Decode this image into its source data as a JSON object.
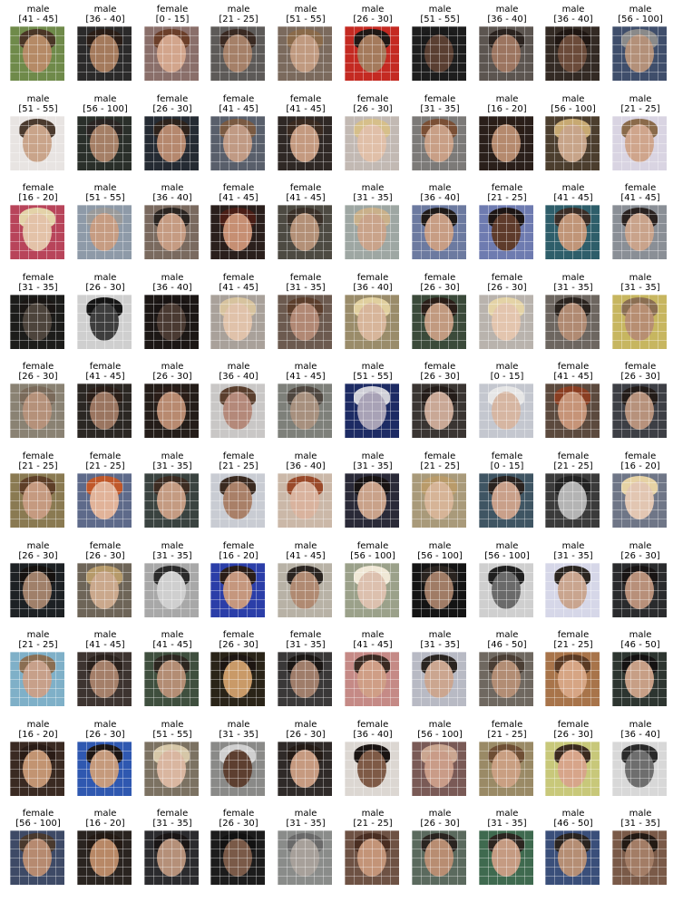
{
  "faces": [
    {
      "gender": "male",
      "age": "[41 - 45]",
      "palette": {
        "bg": "#6f8a4a",
        "skin": "#b58a66",
        "hair": "#4a3626"
      }
    },
    {
      "gender": "male",
      "age": "[36 - 40]",
      "palette": {
        "bg": "#2b2a2a",
        "skin": "#a47a5c",
        "hair": "#2a1d16"
      }
    },
    {
      "gender": "female",
      "age": "[0 - 15]",
      "palette": {
        "bg": "#8a6f6a",
        "skin": "#d2a58c",
        "hair": "#6b3f2a"
      }
    },
    {
      "gender": "male",
      "age": "[21 - 25]",
      "palette": {
        "bg": "#5d5a58",
        "skin": "#a58068",
        "hair": "#3a2a22"
      }
    },
    {
      "gender": "male",
      "age": "[51 - 55]",
      "palette": {
        "bg": "#7b6a5d",
        "skin": "#c09a80",
        "hair": "#8a6a4a"
      }
    },
    {
      "gender": "male",
      "age": "[26 - 30]",
      "palette": {
        "bg": "#c42a22",
        "skin": "#a47a5c",
        "hair": "#1e1714"
      }
    },
    {
      "gender": "male",
      "age": "[51 - 55]",
      "palette": {
        "bg": "#1d1d1d",
        "skin": "#5a3f32",
        "hair": "#1a1a1a"
      }
    },
    {
      "gender": "male",
      "age": "[36 - 40]",
      "palette": {
        "bg": "#5c5550",
        "skin": "#9c7560",
        "hair": "#2b231f"
      }
    },
    {
      "gender": "male",
      "age": "[36 - 40]",
      "palette": {
        "bg": "#332a24",
        "skin": "#6b4b3a",
        "hair": "#1f1612"
      }
    },
    {
      "gender": "male",
      "age": "[56 - 100]",
      "palette": {
        "bg": "#3f4e6b",
        "skin": "#b39079",
        "hair": "#8a8a8a"
      }
    },
    {
      "gender": "male",
      "age": "[51 - 55]",
      "palette": {
        "bg": "#e8e4e2",
        "skin": "#c9a48a",
        "hair": "#4b3a2e"
      }
    },
    {
      "gender": "male",
      "age": "[56 - 100]",
      "palette": {
        "bg": "#2a2f2a",
        "skin": "#a57f66",
        "hair": "#2a2422"
      }
    },
    {
      "gender": "female",
      "age": "[26 - 30]",
      "palette": {
        "bg": "#252b33",
        "skin": "#b5886e",
        "hair": "#2e231c"
      }
    },
    {
      "gender": "female",
      "age": "[41 - 45]",
      "palette": {
        "bg": "#595f6b",
        "skin": "#c09a84",
        "hair": "#7a5a42"
      }
    },
    {
      "gender": "female",
      "age": "[41 - 45]",
      "palette": {
        "bg": "#2f2825",
        "skin": "#c49a80",
        "hair": "#3a2a20"
      }
    },
    {
      "gender": "female",
      "age": "[26 - 30]",
      "palette": {
        "bg": "#c2b9b3",
        "skin": "#e0bfa8",
        "hair": "#d6bf8a"
      }
    },
    {
      "gender": "female",
      "age": "[31 - 35]",
      "palette": {
        "bg": "#7c7a78",
        "skin": "#c89f86",
        "hair": "#7a4f35"
      }
    },
    {
      "gender": "male",
      "age": "[16 - 20]",
      "palette": {
        "bg": "#2a1f1a",
        "skin": "#b58a6e",
        "hair": "#2a1d16"
      }
    },
    {
      "gender": "male",
      "age": "[56 - 100]",
      "palette": {
        "bg": "#4c3e2e",
        "skin": "#c7a489",
        "hair": "#c7a972"
      }
    },
    {
      "gender": "male",
      "age": "[21 - 25]",
      "palette": {
        "bg": "#d9d4e2",
        "skin": "#cfa58c",
        "hair": "#8a6a4a"
      }
    },
    {
      "gender": "female",
      "age": "[16 - 20]",
      "palette": {
        "bg": "#b8445a",
        "skin": "#e3c2a8",
        "hair": "#e3d2a8"
      }
    },
    {
      "gender": "male",
      "age": "[51 - 55]",
      "palette": {
        "bg": "#8e9aa8",
        "skin": "#c69c82",
        "hair": "#9a9a9a"
      }
    },
    {
      "gender": "male",
      "age": "[36 - 40]",
      "palette": {
        "bg": "#7a6a5f",
        "skin": "#c59b82",
        "hair": "#2a2420"
      }
    },
    {
      "gender": "female",
      "age": "[41 - 45]",
      "palette": {
        "bg": "#2a1f1c",
        "skin": "#c68f73",
        "hair": "#4a1e16"
      }
    },
    {
      "gender": "female",
      "age": "[41 - 45]",
      "palette": {
        "bg": "#4d4a42",
        "skin": "#b39077",
        "hair": "#3a3028"
      }
    },
    {
      "gender": "male",
      "age": "[31 - 35]",
      "palette": {
        "bg": "#9ea7a3",
        "skin": "#c9a38a",
        "hair": "#c9b08a"
      }
    },
    {
      "gender": "male",
      "age": "[36 - 40]",
      "palette": {
        "bg": "#6c7aa0",
        "skin": "#c79d84",
        "hair": "#1f1a18"
      }
    },
    {
      "gender": "female",
      "age": "[21 - 25]",
      "palette": {
        "bg": "#6e7bb0",
        "skin": "#5e3b2b",
        "hair": "#1c1514"
      }
    },
    {
      "gender": "male",
      "age": "[41 - 45]",
      "palette": {
        "bg": "#2e5e6a",
        "skin": "#c09578",
        "hair": "#3a2d26"
      }
    },
    {
      "gender": "female",
      "age": "[41 - 45]",
      "palette": {
        "bg": "#8a8f96",
        "skin": "#c9a38b",
        "hair": "#2a2220"
      }
    },
    {
      "gender": "female",
      "age": "[31 - 35]",
      "palette": {
        "bg": "#1c1c1a",
        "skin": "#4d443c",
        "hair": "#1a1614"
      }
    },
    {
      "gender": "male",
      "age": "[26 - 30]",
      "palette": {
        "bg": "#cfcfcf",
        "skin": "#3d3d3d",
        "hair": "#141414"
      }
    },
    {
      "gender": "male",
      "age": "[36 - 40]",
      "palette": {
        "bg": "#1c1715",
        "skin": "#4a3a32",
        "hair": "#181312"
      }
    },
    {
      "gender": "female",
      "age": "[41 - 45]",
      "palette": {
        "bg": "#a9a19a",
        "skin": "#e0c2aa",
        "hair": "#d7c39e"
      }
    },
    {
      "gender": "female",
      "age": "[31 - 35]",
      "palette": {
        "bg": "#6c5a4f",
        "skin": "#b18874",
        "hair": "#5c3e2c"
      }
    },
    {
      "gender": "female",
      "age": "[36 - 40]",
      "palette": {
        "bg": "#9a8c6a",
        "skin": "#d7b59a",
        "hair": "#e0cf9e"
      }
    },
    {
      "gender": "female",
      "age": "[26 - 30]",
      "palette": {
        "bg": "#3b4a3a",
        "skin": "#c19a80",
        "hair": "#2a1e18"
      }
    },
    {
      "gender": "female",
      "age": "[26 - 30]",
      "palette": {
        "bg": "#b9b3ad",
        "skin": "#e3c5ae",
        "hair": "#e4d3a6"
      }
    },
    {
      "gender": "male",
      "age": "[31 - 35]",
      "palette": {
        "bg": "#6d6660",
        "skin": "#b08a72",
        "hair": "#2a231e"
      }
    },
    {
      "gender": "male",
      "age": "[31 - 35]",
      "palette": {
        "bg": "#c7b660",
        "skin": "#b78e72",
        "hair": "#8a6e52"
      }
    },
    {
      "gender": "female",
      "age": "[26 - 30]",
      "palette": {
        "bg": "#8a8273",
        "skin": "#b5917a",
        "hair": "#7a6a5a"
      }
    },
    {
      "gender": "female",
      "age": "[41 - 45]",
      "palette": {
        "bg": "#2b2723",
        "skin": "#9a7560",
        "hair": "#2a1e18"
      }
    },
    {
      "gender": "male",
      "age": "[26 - 30]",
      "palette": {
        "bg": "#241d19",
        "skin": "#b88a70",
        "hair": "#2a1d18"
      }
    },
    {
      "gender": "male",
      "age": "[36 - 40]",
      "palette": {
        "bg": "#c9c7c6",
        "skin": "#b4897a",
        "hair": "#5a3f2e"
      }
    },
    {
      "gender": "male",
      "age": "[41 - 45]",
      "palette": {
        "bg": "#7e807a",
        "skin": "#a7907e",
        "hair": "#4f4740"
      }
    },
    {
      "gender": "male",
      "age": "[51 - 55]",
      "palette": {
        "bg": "#1d2b64",
        "skin": "#a8a2b6",
        "hair": "#d0d0d8"
      }
    },
    {
      "gender": "female",
      "age": "[26 - 30]",
      "palette": {
        "bg": "#3a3532",
        "skin": "#c9a896",
        "hair": "#241c19"
      }
    },
    {
      "gender": "male",
      "age": "[0 - 15]",
      "palette": {
        "bg": "#c4c7cf",
        "skin": "#d6b6a2",
        "hair": "#e6e6e6"
      }
    },
    {
      "gender": "female",
      "age": "[41 - 45]",
      "palette": {
        "bg": "#5c4a3e",
        "skin": "#c69478",
        "hair": "#8a3e22"
      }
    },
    {
      "gender": "female",
      "age": "[26 - 30]",
      "palette": {
        "bg": "#3d3f45",
        "skin": "#b7927c",
        "hair": "#231c19"
      }
    },
    {
      "gender": "female",
      "age": "[21 - 25]",
      "palette": {
        "bg": "#8a7a52",
        "skin": "#c59a80",
        "hair": "#5e3f28"
      }
    },
    {
      "gender": "female",
      "age": "[21 - 25]",
      "palette": {
        "bg": "#5e6a8a",
        "skin": "#e1b399",
        "hair": "#c0582a"
      }
    },
    {
      "gender": "male",
      "age": "[31 - 35]",
      "palette": {
        "bg": "#3a4340",
        "skin": "#c49b82",
        "hair": "#3c2c22"
      }
    },
    {
      "gender": "female",
      "age": "[21 - 25]",
      "palette": {
        "bg": "#c9ccd3",
        "skin": "#a98068",
        "hair": "#3a2a20"
      }
    },
    {
      "gender": "male",
      "age": "[36 - 40]",
      "palette": {
        "bg": "#cbb8a8",
        "skin": "#d9b39e",
        "hair": "#9a4a2a"
      }
    },
    {
      "gender": "male",
      "age": "[31 - 35]",
      "palette": {
        "bg": "#2a2a38",
        "skin": "#c9a28a",
        "hair": "#171313"
      }
    },
    {
      "gender": "female",
      "age": "[21 - 25]",
      "palette": {
        "bg": "#a99a7a",
        "skin": "#d6b497",
        "hair": "#b99b6a"
      }
    },
    {
      "gender": "female",
      "age": "[0 - 15]",
      "palette": {
        "bg": "#3f5563",
        "skin": "#c9a08a",
        "hair": "#2a2320"
      }
    },
    {
      "gender": "female",
      "age": "[21 - 25]",
      "palette": {
        "bg": "#3b3b3b",
        "skin": "#b4b4b4",
        "hair": "#222222"
      }
    },
    {
      "gender": "female",
      "age": "[16 - 20]",
      "palette": {
        "bg": "#6f7687",
        "skin": "#e2c6b2",
        "hair": "#e6d2a4"
      }
    },
    {
      "gender": "male",
      "age": "[26 - 30]",
      "palette": {
        "bg": "#1d2124",
        "skin": "#a0806a",
        "hair": "#161210"
      }
    },
    {
      "gender": "female",
      "age": "[26 - 30]",
      "palette": {
        "bg": "#6e6558",
        "skin": "#caa88c",
        "hair": "#b69a6a"
      }
    },
    {
      "gender": "male",
      "age": "[31 - 35]",
      "palette": {
        "bg": "#a8a8a8",
        "skin": "#cfcfcf",
        "hair": "#2a2a2a"
      }
    },
    {
      "gender": "female",
      "age": "[16 - 20]",
      "palette": {
        "bg": "#2b3ea8",
        "skin": "#c5977e",
        "hair": "#2a1d18"
      }
    },
    {
      "gender": "male",
      "age": "[41 - 45]",
      "palette": {
        "bg": "#b8b2a6",
        "skin": "#b08a72",
        "hair": "#2a2420"
      }
    },
    {
      "gender": "female",
      "age": "[56 - 100]",
      "palette": {
        "bg": "#9ba18a",
        "skin": "#dcc0ae",
        "hair": "#f0e8d6"
      }
    },
    {
      "gender": "male",
      "age": "[56 - 100]",
      "palette": {
        "bg": "#141414",
        "skin": "#a07c66",
        "hair": "#2a2420"
      }
    },
    {
      "gender": "male",
      "age": "[56 - 100]",
      "palette": {
        "bg": "#cfcfcf",
        "skin": "#6a6a6a",
        "hair": "#1f1f1f"
      }
    },
    {
      "gender": "male",
      "age": "[31 - 35]",
      "palette": {
        "bg": "#d6d7e8",
        "skin": "#c9a58f",
        "hair": "#2a2520"
      }
    },
    {
      "gender": "male",
      "age": "[26 - 30]",
      "palette": {
        "bg": "#2a2b2d",
        "skin": "#b8907a",
        "hair": "#181414"
      }
    },
    {
      "gender": "male",
      "age": "[21 - 25]",
      "palette": {
        "bg": "#7fb0c8",
        "skin": "#c7a08a",
        "hair": "#8a6e52"
      }
    },
    {
      "gender": "male",
      "age": "[41 - 45]",
      "palette": {
        "bg": "#3d3430",
        "skin": "#a47f69",
        "hair": "#2a211c"
      }
    },
    {
      "gender": "male",
      "age": "[41 - 45]",
      "palette": {
        "bg": "#3f4f3e",
        "skin": "#b38d74",
        "hair": "#2c2620"
      }
    },
    {
      "gender": "female",
      "age": "[26 - 30]",
      "palette": {
        "bg": "#2a2418",
        "skin": "#c99a68",
        "hair": "#1d1612"
      }
    },
    {
      "gender": "female",
      "age": "[31 - 35]",
      "palette": {
        "bg": "#3a3838",
        "skin": "#9f7d6a",
        "hair": "#1a1614"
      }
    },
    {
      "gender": "male",
      "age": "[41 - 45]",
      "palette": {
        "bg": "#c58a86",
        "skin": "#cf9e86",
        "hair": "#3a2a22"
      }
    },
    {
      "gender": "male",
      "age": "[31 - 35]",
      "palette": {
        "bg": "#b8bac4",
        "skin": "#cba690",
        "hair": "#2a2420"
      }
    },
    {
      "gender": "male",
      "age": "[46 - 50]",
      "palette": {
        "bg": "#6f6860",
        "skin": "#b28d74",
        "hair": "#4a3e34"
      }
    },
    {
      "gender": "female",
      "age": "[21 - 25]",
      "palette": {
        "bg": "#a8744a",
        "skin": "#d6a584",
        "hair": "#5a3a24"
      }
    },
    {
      "gender": "male",
      "age": "[46 - 50]",
      "palette": {
        "bg": "#2d3530",
        "skin": "#c79f86",
        "hair": "#141212"
      }
    },
    {
      "gender": "male",
      "age": "[16 - 20]",
      "palette": {
        "bg": "#3a2a22",
        "skin": "#c29472",
        "hair": "#2a1c16"
      }
    },
    {
      "gender": "male",
      "age": "[26 - 30]",
      "palette": {
        "bg": "#2f58b0",
        "skin": "#c59a7c",
        "hair": "#1c1614"
      }
    },
    {
      "gender": "male",
      "age": "[51 - 55]",
      "palette": {
        "bg": "#7c7262",
        "skin": "#d9b6a0",
        "hair": "#d6c7a8"
      }
    },
    {
      "gender": "male",
      "age": "[31 - 35]",
      "palette": {
        "bg": "#8a8a88",
        "skin": "#5d3f30",
        "hair": "#d0d0d0"
      }
    },
    {
      "gender": "male",
      "age": "[26 - 30]",
      "palette": {
        "bg": "#2f2a28",
        "skin": "#c69a80",
        "hair": "#241b16"
      }
    },
    {
      "gender": "female",
      "age": "[36 - 40]",
      "palette": {
        "bg": "#dcd7d2",
        "skin": "#7e5a46",
        "hair": "#1a1412"
      }
    },
    {
      "gender": "male",
      "age": "[56 - 100]",
      "palette": {
        "bg": "#7a5a56",
        "skin": "#c99c88",
        "hair": "#caa690"
      }
    },
    {
      "gender": "female",
      "age": "[21 - 25]",
      "palette": {
        "bg": "#9a8a66",
        "skin": "#c99f82",
        "hair": "#6e4e34"
      }
    },
    {
      "gender": "female",
      "age": "[26 - 30]",
      "palette": {
        "bg": "#c8c87a",
        "skin": "#d7a58a",
        "hair": "#3a2a1f"
      }
    },
    {
      "gender": "male",
      "age": "[36 - 40]",
      "palette": {
        "bg": "#d8d8d8",
        "skin": "#6e6e6e",
        "hair": "#2a2a2a"
      }
    },
    {
      "gender": "female",
      "age": "[56 - 100]",
      "palette": {
        "bg": "#3e4a66",
        "skin": "#b68a70",
        "hair": "#4a3a2e"
      }
    },
    {
      "gender": "male",
      "age": "[16 - 20]",
      "palette": {
        "bg": "#2a2420",
        "skin": "#b88866",
        "hair": "#241a14"
      }
    },
    {
      "gender": "female",
      "age": "[31 - 35]",
      "palette": {
        "bg": "#2b2b2e",
        "skin": "#b59079",
        "hair": "#1a1616"
      }
    },
    {
      "gender": "female",
      "age": "[26 - 30]",
      "palette": {
        "bg": "#1c1c1c",
        "skin": "#7a5a48",
        "hair": "#121212"
      }
    },
    {
      "gender": "male",
      "age": "[31 - 35]",
      "palette": {
        "bg": "#8a8c8a",
        "skin": "#a7a09a",
        "hair": "#6a6a6a"
      }
    },
    {
      "gender": "male",
      "age": "[21 - 25]",
      "palette": {
        "bg": "#6e5244",
        "skin": "#c39478",
        "hair": "#4a2e22"
      }
    },
    {
      "gender": "male",
      "age": "[26 - 30]",
      "palette": {
        "bg": "#5b6a5e",
        "skin": "#b88d72",
        "hair": "#2a2420"
      }
    },
    {
      "gender": "male",
      "age": "[31 - 35]",
      "palette": {
        "bg": "#3f6a4f",
        "skin": "#c59b82",
        "hair": "#2c2520"
      }
    },
    {
      "gender": "male",
      "age": "[46 - 50]",
      "palette": {
        "bg": "#3a4f7a",
        "skin": "#b58e74",
        "hair": "#2a2420"
      }
    },
    {
      "gender": "male",
      "age": "[31 - 35]",
      "palette": {
        "bg": "#7a5a48",
        "skin": "#a37d66",
        "hair": "#231a14"
      }
    }
  ]
}
